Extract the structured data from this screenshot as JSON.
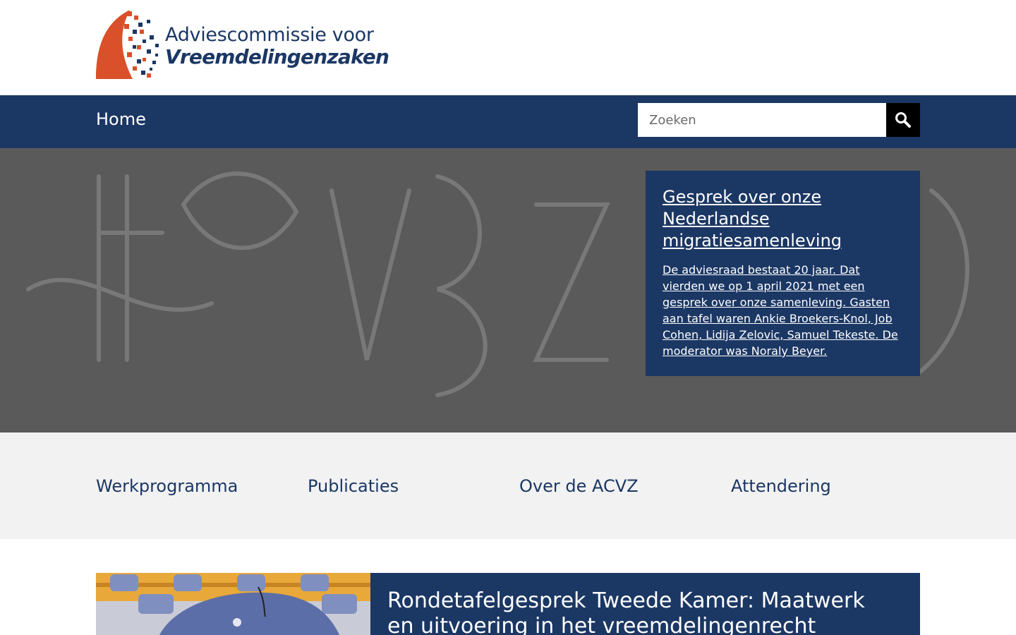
{
  "site": {
    "logo": {
      "line1": "Adviescommissie voor",
      "line2": "Vreemdelingenzaken",
      "colors": {
        "orange": "#d9502a",
        "navy": "#1b3764"
      }
    }
  },
  "nav": {
    "home_label": "Home",
    "search": {
      "placeholder": "Zoeken",
      "value": ""
    }
  },
  "hero": {
    "card": {
      "title": "Gesprek over onze Nederlandse migratiesamenleving",
      "text": "De adviesraad bestaat 20 jaar. Dat vierden we op 1 april 2021 met een gesprek over onze samenleving. Gasten aan tafel waren Ankie Broekers-Knol, Job Cohen, Lidija Zelovic, Samuel Tekeste. De moderator was Noraly Beyer."
    }
  },
  "quicklinks": [
    {
      "label": "Werkprogramma"
    },
    {
      "label": "Publicaties"
    },
    {
      "label": "Over de ACVZ"
    },
    {
      "label": "Attendering"
    }
  ],
  "news": {
    "title": "Rondetafelgesprek Tweede Kamer: Maatwerk en uitvoering in het vreemdelingenrecht"
  },
  "colors": {
    "primary": "#1b3764",
    "accent": "#d9502a",
    "hero_bg": "#5a5a5a",
    "quicklinks_bg": "#f2f2f2"
  }
}
